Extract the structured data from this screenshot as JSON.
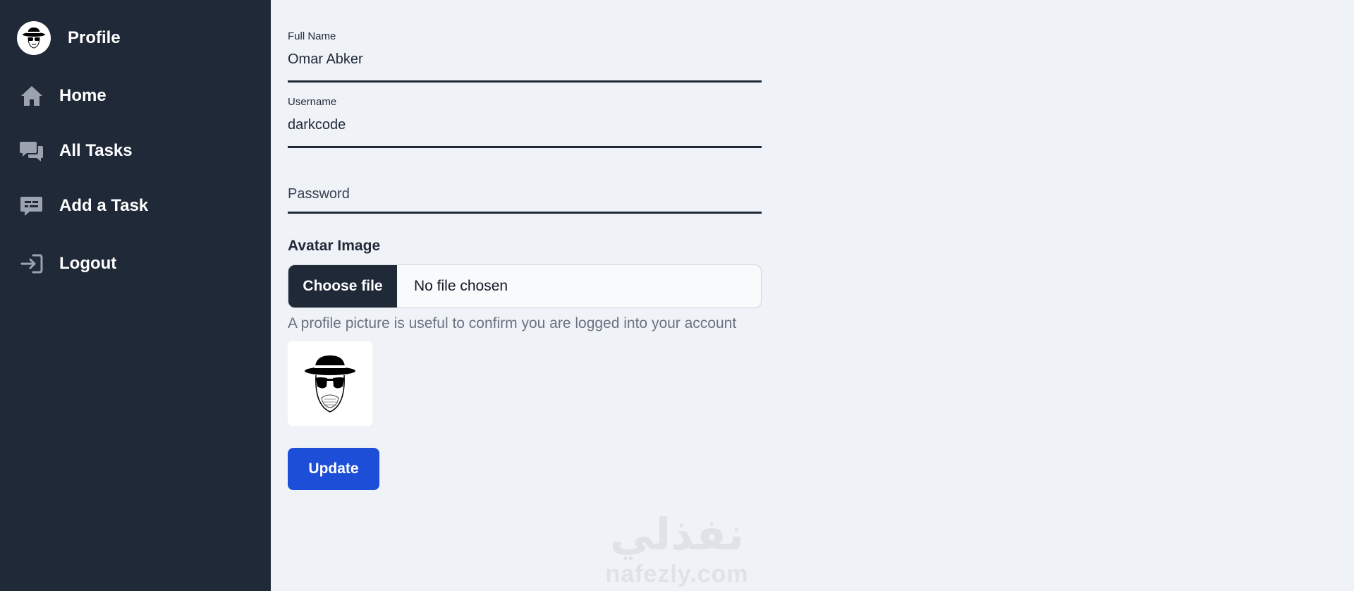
{
  "sidebar": {
    "profile": {
      "label": "Profile",
      "icon": "heisenberg-avatar-icon"
    },
    "items": [
      {
        "label": "Home",
        "icon": "home-icon"
      },
      {
        "label": "All Tasks",
        "icon": "chat-bubbles-icon"
      },
      {
        "label": "Add a Task",
        "icon": "message-add-icon"
      },
      {
        "label": "Logout",
        "icon": "logout-icon"
      }
    ]
  },
  "form": {
    "full_name": {
      "label": "Full Name",
      "value": "Omar Abker"
    },
    "username": {
      "label": "Username",
      "value": "darkcode"
    },
    "password": {
      "placeholder": "Password"
    },
    "avatar": {
      "heading": "Avatar Image",
      "choose_label": "Choose file",
      "status": "No file chosen",
      "help": "A profile picture is useful to confirm you are logged into your account"
    },
    "update_label": "Update"
  },
  "watermark": {
    "arabic": "نفذلي",
    "latin": "nafezly.com"
  },
  "colors": {
    "sidebar_bg": "#1f2937",
    "page_bg": "#eff3f8",
    "accent": "#1d4ed8",
    "icon_gray": "#9ca3af"
  }
}
